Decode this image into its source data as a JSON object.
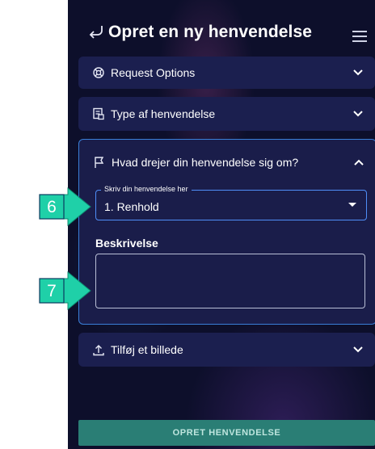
{
  "header": {
    "title": "Opret en ny henvendelse"
  },
  "panels": {
    "request_options": {
      "label": "Request Options"
    },
    "type": {
      "label": "Type af henvendelse"
    },
    "about": {
      "label": "Hvad drejer din henvendelse sig om?"
    },
    "attach": {
      "label": "Tilføj et billede"
    }
  },
  "form": {
    "select_label": "Skriv din henvendelse her",
    "select_value": "1. Renhold",
    "description_label": "Beskrivelse"
  },
  "submit_label": "OPRET HENVENDELSE",
  "annotations": {
    "arrow_6": "6",
    "arrow_7": "7"
  },
  "colors": {
    "app_bg": "#0d0f2b",
    "panel_bg": "#1b1f4f",
    "accent_border": "#3a7fd8",
    "arrow": "#1fd0a8",
    "submit": "#2a7e75"
  },
  "icons": [
    "back-arrow-icon",
    "hamburger-menu-icon",
    "lifebuoy-icon",
    "document-icon",
    "flag-icon",
    "upload-icon",
    "chevron-down-icon",
    "chevron-up-icon"
  ]
}
